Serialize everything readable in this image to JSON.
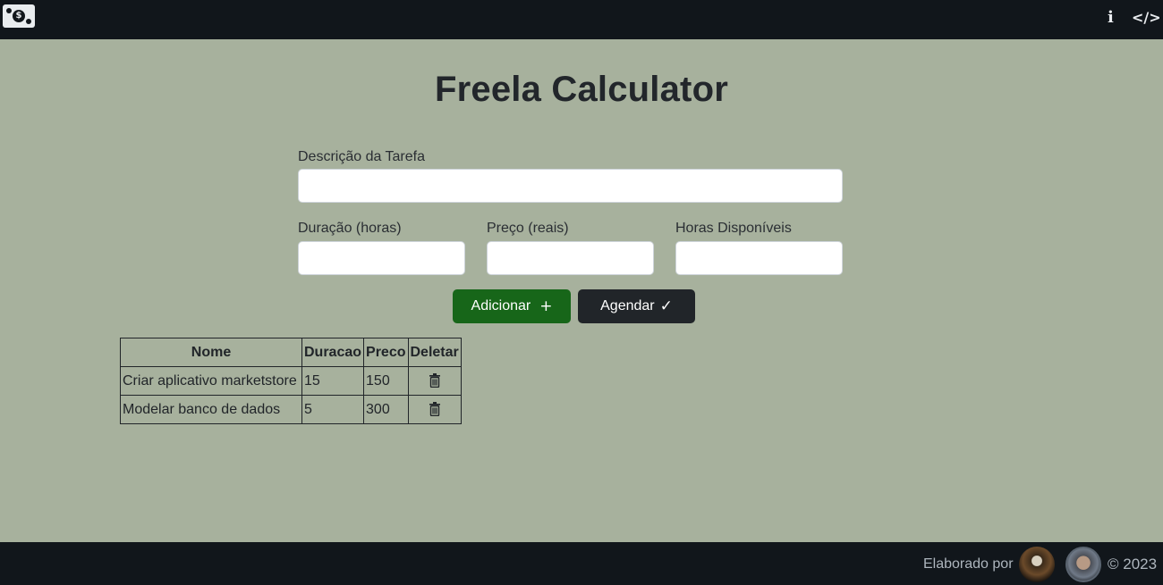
{
  "header": {
    "logo_icon": "money-bill-icon",
    "logo_symbol": "$",
    "info_icon": "i",
    "code_icon": "</>"
  },
  "main": {
    "title": "Freela Calculator",
    "fields": {
      "description_label": "Descrição da Tarefa",
      "description_value": "",
      "duration_label": "Duração (horas)",
      "duration_value": "",
      "price_label": "Preço (reais)",
      "price_value": "",
      "hours_label": "Horas Disponíveis",
      "hours_value": ""
    },
    "buttons": {
      "add_label": "Adicionar",
      "add_icon": "+",
      "schedule_label": "Agendar",
      "schedule_icon": "✓"
    }
  },
  "table": {
    "headers": [
      "Nome",
      "Duracao",
      "Preco",
      "Deletar"
    ],
    "rows": [
      {
        "nome": "Criar aplicativo marketstore",
        "duracao": "15",
        "preco": "150",
        "delete_icon": "trash-icon"
      },
      {
        "nome": "Modelar banco de dados",
        "duracao": "5",
        "preco": "300",
        "delete_icon": "trash-icon"
      }
    ]
  },
  "footer": {
    "credit": "Elaborado por",
    "copyright": "© 2023"
  },
  "colors": {
    "background": "#a7b19d",
    "bar": "#11161b",
    "add_button": "#176619",
    "schedule_button": "#212529"
  }
}
